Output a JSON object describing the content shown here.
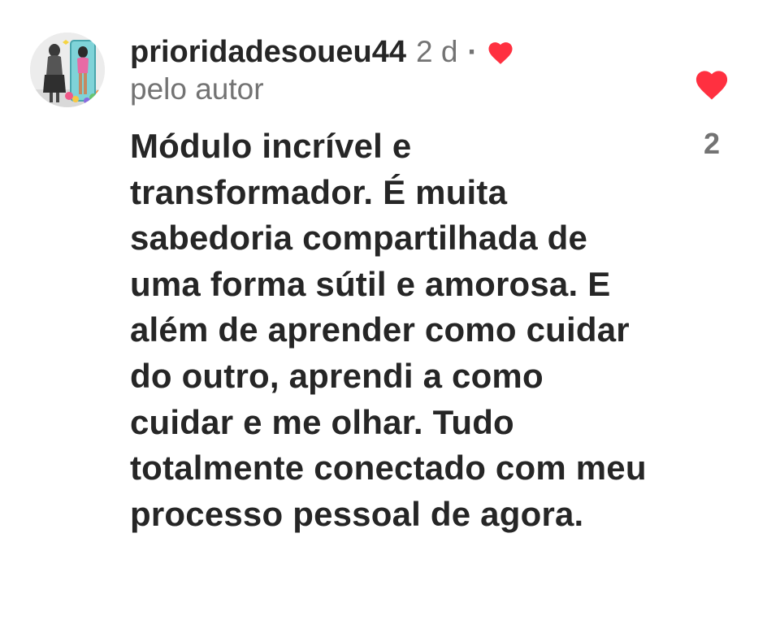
{
  "comment": {
    "username": "prioridadesoueu44",
    "time": "2 d",
    "separator": "·",
    "author_label": "pelo autor",
    "text": "Módulo incrível e transformador. É muita sabedoria compartilhada de uma forma sútil e amorosa. E além de aprender como cuidar do outro, aprendi a como cuidar e me olhar. Tudo totalmente conectado com meu processo pessoal de agora.",
    "likes": "2"
  },
  "icons": {
    "author_like": "heart-icon",
    "like_button": "heart-icon"
  },
  "colors": {
    "heart": "#ff3040",
    "text": "#262626",
    "muted": "#737373"
  }
}
